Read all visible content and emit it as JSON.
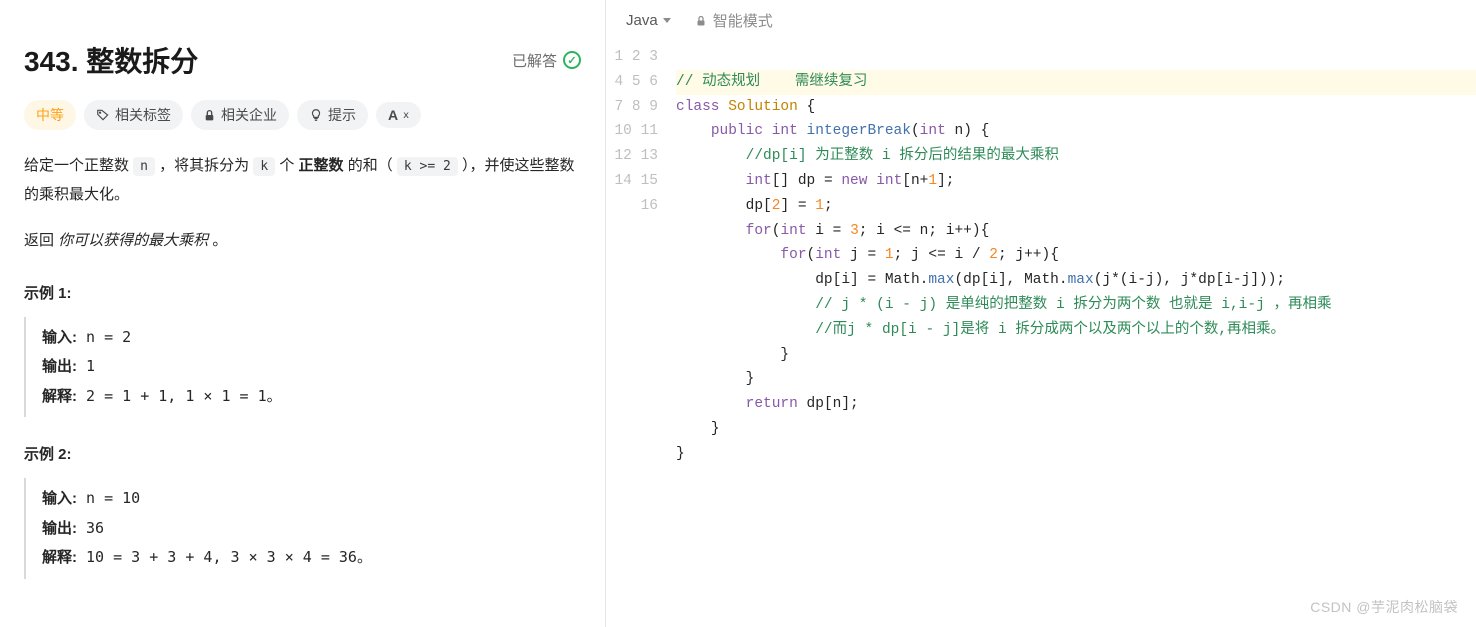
{
  "problem": {
    "title": "343. 整数拆分",
    "solved_label": "已解答",
    "difficulty": "中等",
    "tags": {
      "related_tags": "相关标签",
      "related_companies": "相关企业",
      "hint": "提示",
      "font": "A"
    },
    "desc_parts": {
      "p1a": "给定一个正整数 ",
      "p1_n": "n",
      "p1b": " ，将其拆分为 ",
      "p1_k": "k",
      "p1c": " 个 ",
      "p1_bold": "正整数",
      "p1d": " 的和（ ",
      "p1_code2": "k >= 2",
      "p1e": " ），并使这些整数的乘积最大化。",
      "p2a": "返回 ",
      "p2_italic": "你可以获得的最大乘积",
      "p2b": " 。"
    },
    "examples": [
      {
        "title": "示例 1:",
        "input_label": "输入:",
        "input_val": " n = 2",
        "output_label": "输出:",
        "output_val": " 1",
        "explain_label": "解释:",
        "explain_val": " 2 = 1 + 1, 1 × 1 = 1。"
      },
      {
        "title": "示例 2:",
        "input_label": "输入:",
        "input_val": " n = 10",
        "output_label": "输出:",
        "output_val": " 36",
        "explain_label": "解释:",
        "explain_val": " 10 = 3 + 3 + 4, 3 × 3 × 4 = 36。"
      }
    ]
  },
  "editor": {
    "language": "Java",
    "smart_mode": "智能模式",
    "line_count": 16,
    "code": {
      "l1_comment": "// 动态规划    需继续复习",
      "l2_class": "class",
      "l2_name": "Solution",
      "l2_brace": " {",
      "l3_pad": "    ",
      "l3_public": "public",
      "l3_int": " int",
      "l3_fn": " integerBreak",
      "l3_paren1": "(",
      "l3_argtype": "int",
      "l3_argname": " n",
      "l3_paren2": ") {",
      "l4_pad": "        ",
      "l4_comment": "//dp[i] 为正整数 i 拆分后的结果的最大乘积",
      "l5_pad": "        ",
      "l5_a": "int",
      "l5_b": "[] dp = ",
      "l5_new": "new",
      "l5_c": " int",
      "l5_d": "[n+",
      "l5_num": "1",
      "l5_e": "];",
      "l6_pad": "        ",
      "l6_a": "dp[",
      "l6_n1": "2",
      "l6_b": "] = ",
      "l6_n2": "1",
      "l6_c": ";",
      "l7_pad": "        ",
      "l7_for": "for",
      "l7_a": "(",
      "l7_int": "int",
      "l7_b": " i = ",
      "l7_n1": "3",
      "l7_c": "; i <= n; i++){",
      "l8_pad": "            ",
      "l8_for": "for",
      "l8_a": "(",
      "l8_int": "int",
      "l8_b": " j = ",
      "l8_n1": "1",
      "l8_c": "; j <= i / ",
      "l8_n2": "2",
      "l8_d": "; j++){",
      "l9_pad": "                ",
      "l9_a": "dp[i] = Math.",
      "l9_max1": "max",
      "l9_b": "(dp[i], Math.",
      "l9_max2": "max",
      "l9_c": "(j*(i-j), j*dp[i-j]));",
      "l10_pad": "                ",
      "l10_comment": "// j * (i - j) 是单纯的把整数 i 拆分为两个数 也就是 i,i-j ，再相乘",
      "l11_pad": "                ",
      "l11_comment": "//而j * dp[i - j]是将 i 拆分成两个以及两个以上的个数,再相乘。",
      "l12_pad": "            ",
      "l12_a": "}",
      "l13_pad": "        ",
      "l13_a": "}",
      "l14_pad": "        ",
      "l14_ret": "return",
      "l14_a": " dp[n];",
      "l15_pad": "    ",
      "l15_a": "}",
      "l16_a": "}"
    }
  },
  "watermark": "CSDN @芋泥肉松脑袋"
}
